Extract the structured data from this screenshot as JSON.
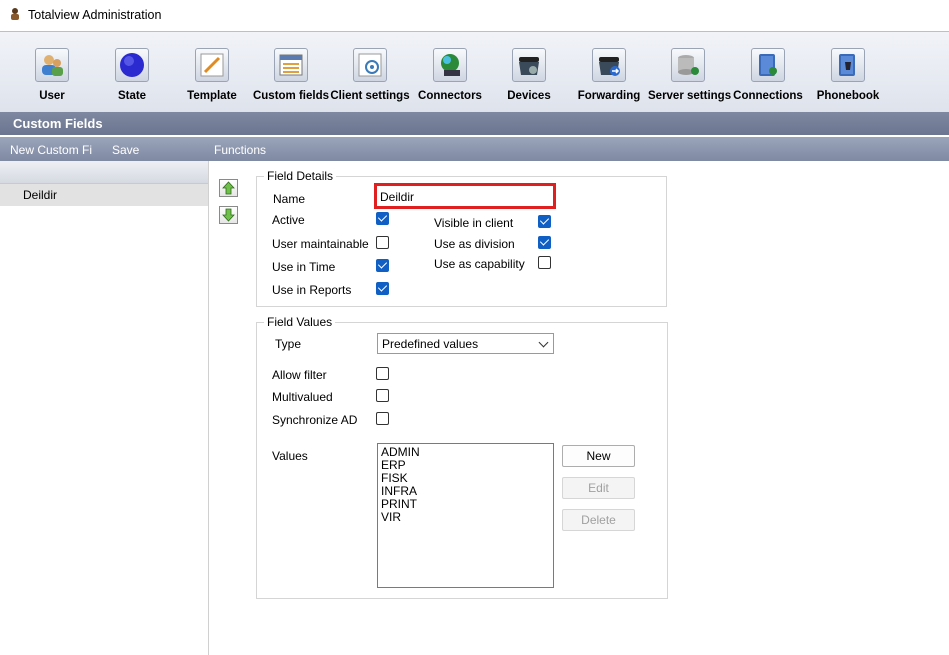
{
  "window": {
    "title": "Totalview  Administration"
  },
  "toolbar": {
    "items": [
      {
        "label": "User",
        "icon": "users-icon"
      },
      {
        "label": "State",
        "icon": "state-globe-icon"
      },
      {
        "label": "Template",
        "icon": "template-pencil-icon"
      },
      {
        "label": "Custom fields",
        "icon": "custom-fields-icon"
      },
      {
        "label": "Client settings",
        "icon": "client-settings-icon"
      },
      {
        "label": "Connectors",
        "icon": "connectors-icon"
      },
      {
        "label": "Devices",
        "icon": "devices-phone-icon"
      },
      {
        "label": "Forwarding",
        "icon": "forwarding-phone-icon"
      },
      {
        "label": "Server settings",
        "icon": "server-database-icon"
      },
      {
        "label": "Connections",
        "icon": "connections-book-icon"
      },
      {
        "label": "Phonebook",
        "icon": "phonebook-icon"
      }
    ]
  },
  "section": {
    "title": "Custom Fields"
  },
  "menu": {
    "new": "New Custom Fi",
    "save": "Save",
    "functions": "Functions"
  },
  "left_list": {
    "items": [
      "Deildir"
    ]
  },
  "field_details": {
    "legend": "Field Details",
    "name_label": "Name",
    "name_value": "Deildir",
    "active_label": "Active",
    "active": true,
    "user_maintainable_label": "User maintainable",
    "user_maintainable": false,
    "use_in_time_label": "Use in Time",
    "use_in_time": true,
    "use_in_reports_label": "Use in Reports",
    "use_in_reports": true,
    "visible_in_client_label": "Visible in client",
    "visible_in_client": true,
    "use_as_division_label": "Use as division",
    "use_as_division": true,
    "use_as_capability_label": "Use as capability",
    "use_as_capability": false
  },
  "field_values": {
    "legend": "Field Values",
    "type_label": "Type",
    "type_value": "Predefined values",
    "allow_filter_label": "Allow filter",
    "allow_filter": false,
    "multivalued_label": "Multivalued",
    "multivalued": false,
    "sync_ad_label": "Synchronize AD",
    "sync_ad": false,
    "values_label": "Values",
    "values": [
      "ADMIN",
      "ERP",
      "FISK",
      "INFRA",
      "PRINT",
      "VIR"
    ],
    "new_button": "New",
    "edit_button": "Edit",
    "delete_button": "Delete"
  },
  "colors": {
    "accent": "#0f5fc4",
    "highlight_border": "#e02020",
    "band": "#6b7590"
  }
}
